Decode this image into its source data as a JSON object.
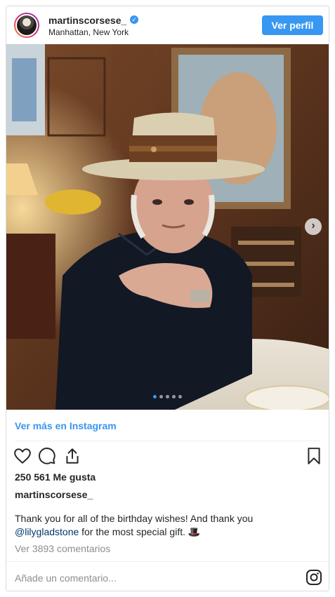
{
  "header": {
    "username": "martinscorsese_",
    "location": "Manhattan, New York",
    "profile_button": "Ver perfil"
  },
  "carousel": {
    "slide_count": 5,
    "active_index": 0,
    "next_arrow_icon": "chevron-right-icon"
  },
  "links": {
    "view_more": "Ver más en Instagram"
  },
  "actions": {
    "icons": [
      "heart-icon",
      "comment-icon",
      "share-icon",
      "bookmark-icon"
    ]
  },
  "post": {
    "likes": "250 561 Me gusta",
    "caption_user": "martinscorsese_",
    "caption_part1": "Thank you for all of the birthday wishes! And thank you",
    "mention": "@lilygladstone",
    "caption_part2": " for the most special gift. ",
    "caption_emoji": "🎩",
    "comments_link": "Ver 3893 comentarios"
  },
  "comment_box": {
    "placeholder": "Añade un comentario...",
    "logo_icon": "instagram-icon"
  },
  "colors": {
    "accent": "#3897f0",
    "text": "#262626",
    "muted": "#8e8e8e",
    "border": "#dbdbdb"
  }
}
